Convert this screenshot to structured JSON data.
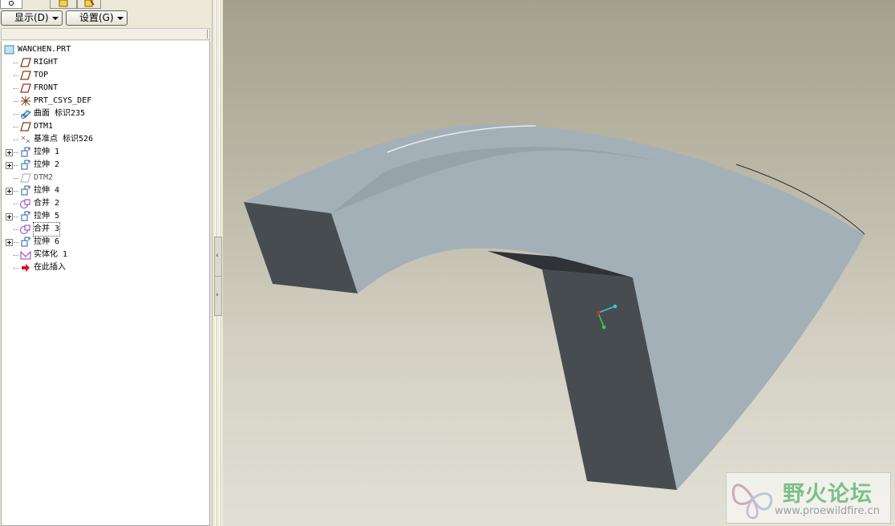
{
  "toolbar": {
    "show_label": "显示(D)",
    "settings_label": "设置(G)"
  },
  "tree": {
    "root": "WANCHEN.PRT",
    "items": [
      {
        "label": "RIGHT",
        "icon": "datum-plane-icon",
        "expandable": false
      },
      {
        "label": "TOP",
        "icon": "datum-plane-icon",
        "expandable": false
      },
      {
        "label": "FRONT",
        "icon": "datum-plane-icon",
        "expandable": false
      },
      {
        "label": "PRT_CSYS_DEF",
        "icon": "coordinate-system-icon",
        "expandable": false
      },
      {
        "label": "曲面 标识235",
        "icon": "surface-icon",
        "expandable": false
      },
      {
        "label": "DTM1",
        "icon": "datum-plane-icon",
        "expandable": false
      },
      {
        "label": "基准点 标识526",
        "icon": "datum-point-icon",
        "expandable": false
      },
      {
        "label": "拉伸 1",
        "icon": "extrude-icon",
        "expandable": true
      },
      {
        "label": "拉伸 2",
        "icon": "extrude-icon",
        "expandable": true
      },
      {
        "label": "DTM2",
        "icon": "datum-plane-hidden-icon",
        "expandable": false
      },
      {
        "label": "拉伸 4",
        "icon": "extrude-icon",
        "expandable": true
      },
      {
        "label": "合并 2",
        "icon": "merge-icon",
        "expandable": false
      },
      {
        "label": "拉伸 5",
        "icon": "extrude-icon",
        "expandable": true
      },
      {
        "label": "合并 3",
        "icon": "merge-icon",
        "expandable": false,
        "selected": true
      },
      {
        "label": "拉伸 6",
        "icon": "extrude-icon",
        "expandable": true
      },
      {
        "label": "实体化 1",
        "icon": "solidify-icon",
        "expandable": false
      },
      {
        "label": "在此插入",
        "icon": "insert-here-arrow-icon",
        "expandable": false
      }
    ]
  },
  "watermark": {
    "title": "野火论坛",
    "url": "www.proewildfire.cn"
  },
  "colors": {
    "model_top": "#a4b0b8",
    "model_side_dark": "#474c51",
    "datum_plane": "#8a3b12",
    "feature_icon": "#1d5fa8",
    "merge_icon": "#9a3aa8"
  }
}
